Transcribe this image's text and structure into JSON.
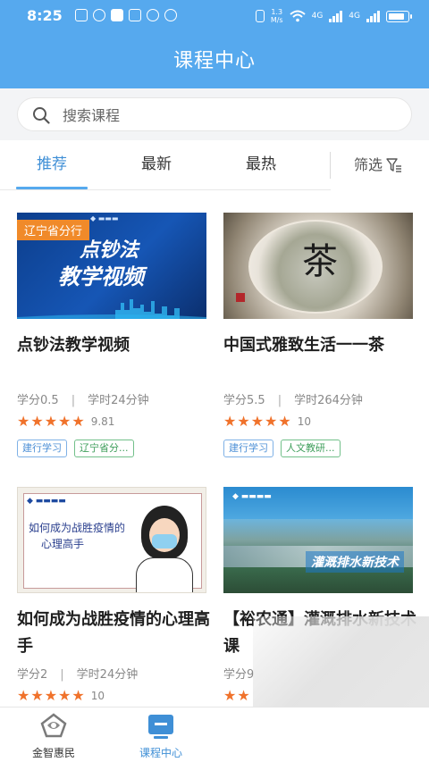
{
  "status_bar": {
    "time": "8:25",
    "speed_value": "1.3",
    "speed_unit": "M/s",
    "net_label_1": "4G",
    "net_label_2": "4G"
  },
  "header": {
    "title": "课程中心"
  },
  "search": {
    "placeholder": "搜索课程",
    "value": ""
  },
  "tabs": [
    {
      "label": "推荐",
      "active": true
    },
    {
      "label": "最新",
      "active": false
    },
    {
      "label": "最热",
      "active": false
    }
  ],
  "filter": {
    "label": "筛选",
    "icon": "filter-icon"
  },
  "courses": [
    {
      "title": "点钞法教学视频",
      "credit": "学分0.5",
      "hours": "学时24分钟",
      "stars": 5,
      "rating": "9.81",
      "tags": [
        "建行学习",
        "辽宁省分..."
      ],
      "thumb": {
        "badge": "辽宁省分行",
        "line1": "点钞法",
        "line2": "教学视频"
      }
    },
    {
      "title": "中国式雅致生活一一茶",
      "credit": "学分5.5",
      "hours": "学时264分钟",
      "stars": 5,
      "rating": "10",
      "tags": [
        "建行学习",
        "人文教研..."
      ],
      "thumb": {
        "char": "茶"
      }
    },
    {
      "title": "如何成为战胜疫情的心理高手",
      "credit": "学分2",
      "hours": "学时24分钟",
      "stars": 5,
      "rating": "10",
      "tags": [],
      "thumb": {
        "text1": "如何成为战胜疫情的",
        "text2": "心理高手"
      }
    },
    {
      "title": "【裕农通】灌溉排水新技术课",
      "credit": "学分9",
      "hours": "",
      "stars": 2,
      "rating": "",
      "tags": [],
      "thumb": {
        "label": "灌溉排水新技术"
      }
    }
  ],
  "bottom_nav": [
    {
      "label": "金智惠民",
      "icon": "jinzhi-logo-icon",
      "active": false
    },
    {
      "label": "课程中心",
      "icon": "course-center-icon",
      "active": true
    }
  ],
  "colors": {
    "primary": "#56a9ee",
    "tab_active": "#3f8fd6",
    "star": "#f0722b",
    "tag_blue": "#4c8fd6",
    "tag_green": "#3f9e5b"
  }
}
